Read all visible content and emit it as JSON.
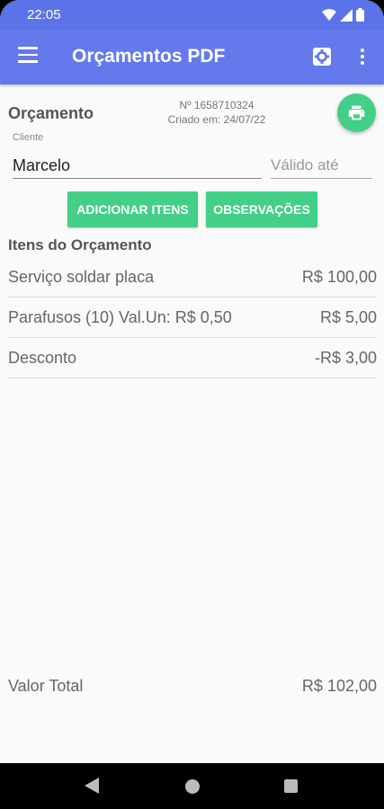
{
  "status": {
    "time": "22:05"
  },
  "appbar": {
    "title": "Orçamentos PDF",
    "icons": [
      "menu-icon",
      "gear-icon",
      "more-vert-icon"
    ]
  },
  "header": {
    "title": "Orçamento",
    "number": "Nº 1658710324",
    "created": "Criado em: 24/07/22"
  },
  "form": {
    "cliente_label": "Cliente",
    "cliente_value": "Marcelo",
    "valido_placeholder": "Válido até"
  },
  "buttons": {
    "add_items": "ADICIONAR ITENS",
    "observacoes": "OBSERVAÇÕES"
  },
  "items_section": {
    "title": "Itens do Orçamento",
    "items": [
      {
        "desc": "Serviço soldar placa",
        "value": "R$ 100,00"
      },
      {
        "desc": "Parafusos (10) Val.Un: R$ 0,50",
        "value": "R$ 5,00"
      },
      {
        "desc": "Desconto",
        "value": "-R$ 3,00"
      }
    ]
  },
  "total": {
    "label": "Valor Total",
    "value": "R$ 102,00"
  },
  "colors": {
    "appbar": "#6479ec",
    "statusbar": "#5b73e8",
    "accent": "#43cf87"
  }
}
